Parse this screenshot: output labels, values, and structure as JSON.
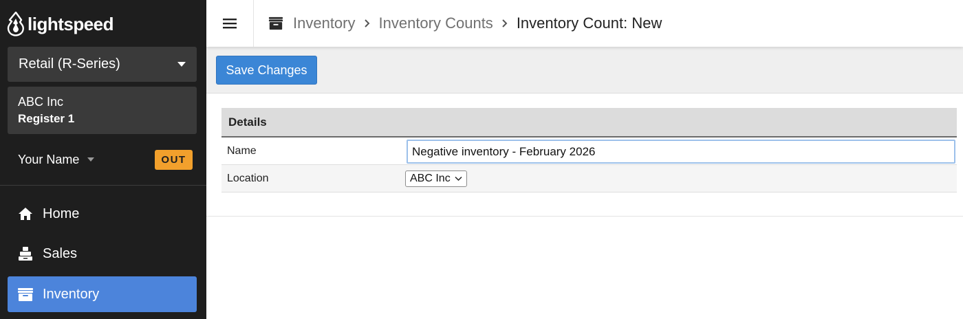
{
  "brand": {
    "name": "lightspeed"
  },
  "sidebar": {
    "product_select": "Retail (R-Series)",
    "shop": {
      "company": "ABC Inc",
      "register": "Register 1"
    },
    "user": {
      "name": "Your Name",
      "status_badge": "OUT"
    },
    "nav": [
      {
        "label": "Home",
        "icon": "home-icon"
      },
      {
        "label": "Sales",
        "icon": "register-icon"
      },
      {
        "label": "Inventory",
        "icon": "inventory-box-icon",
        "active": true
      }
    ]
  },
  "header": {
    "menu_icon": "hamburger-menu-icon",
    "breadcrumb_icon": "inventory-box-icon",
    "breadcrumb": [
      "Inventory",
      "Inventory Counts"
    ],
    "current": "Inventory Count: New"
  },
  "toolbar": {
    "save_label": "Save Changes"
  },
  "form": {
    "section_title": "Details",
    "name_label": "Name",
    "name_value": "Negative inventory - February 2026",
    "location_label": "Location",
    "location_value": "ABC Inc"
  },
  "colors": {
    "sidebar_bg": "#1e1e1e",
    "sidebar_panel": "#3a3a3a",
    "active_nav": "#4c84db",
    "out_badge": "#f2a02c",
    "save_button": "#3b86d6"
  }
}
